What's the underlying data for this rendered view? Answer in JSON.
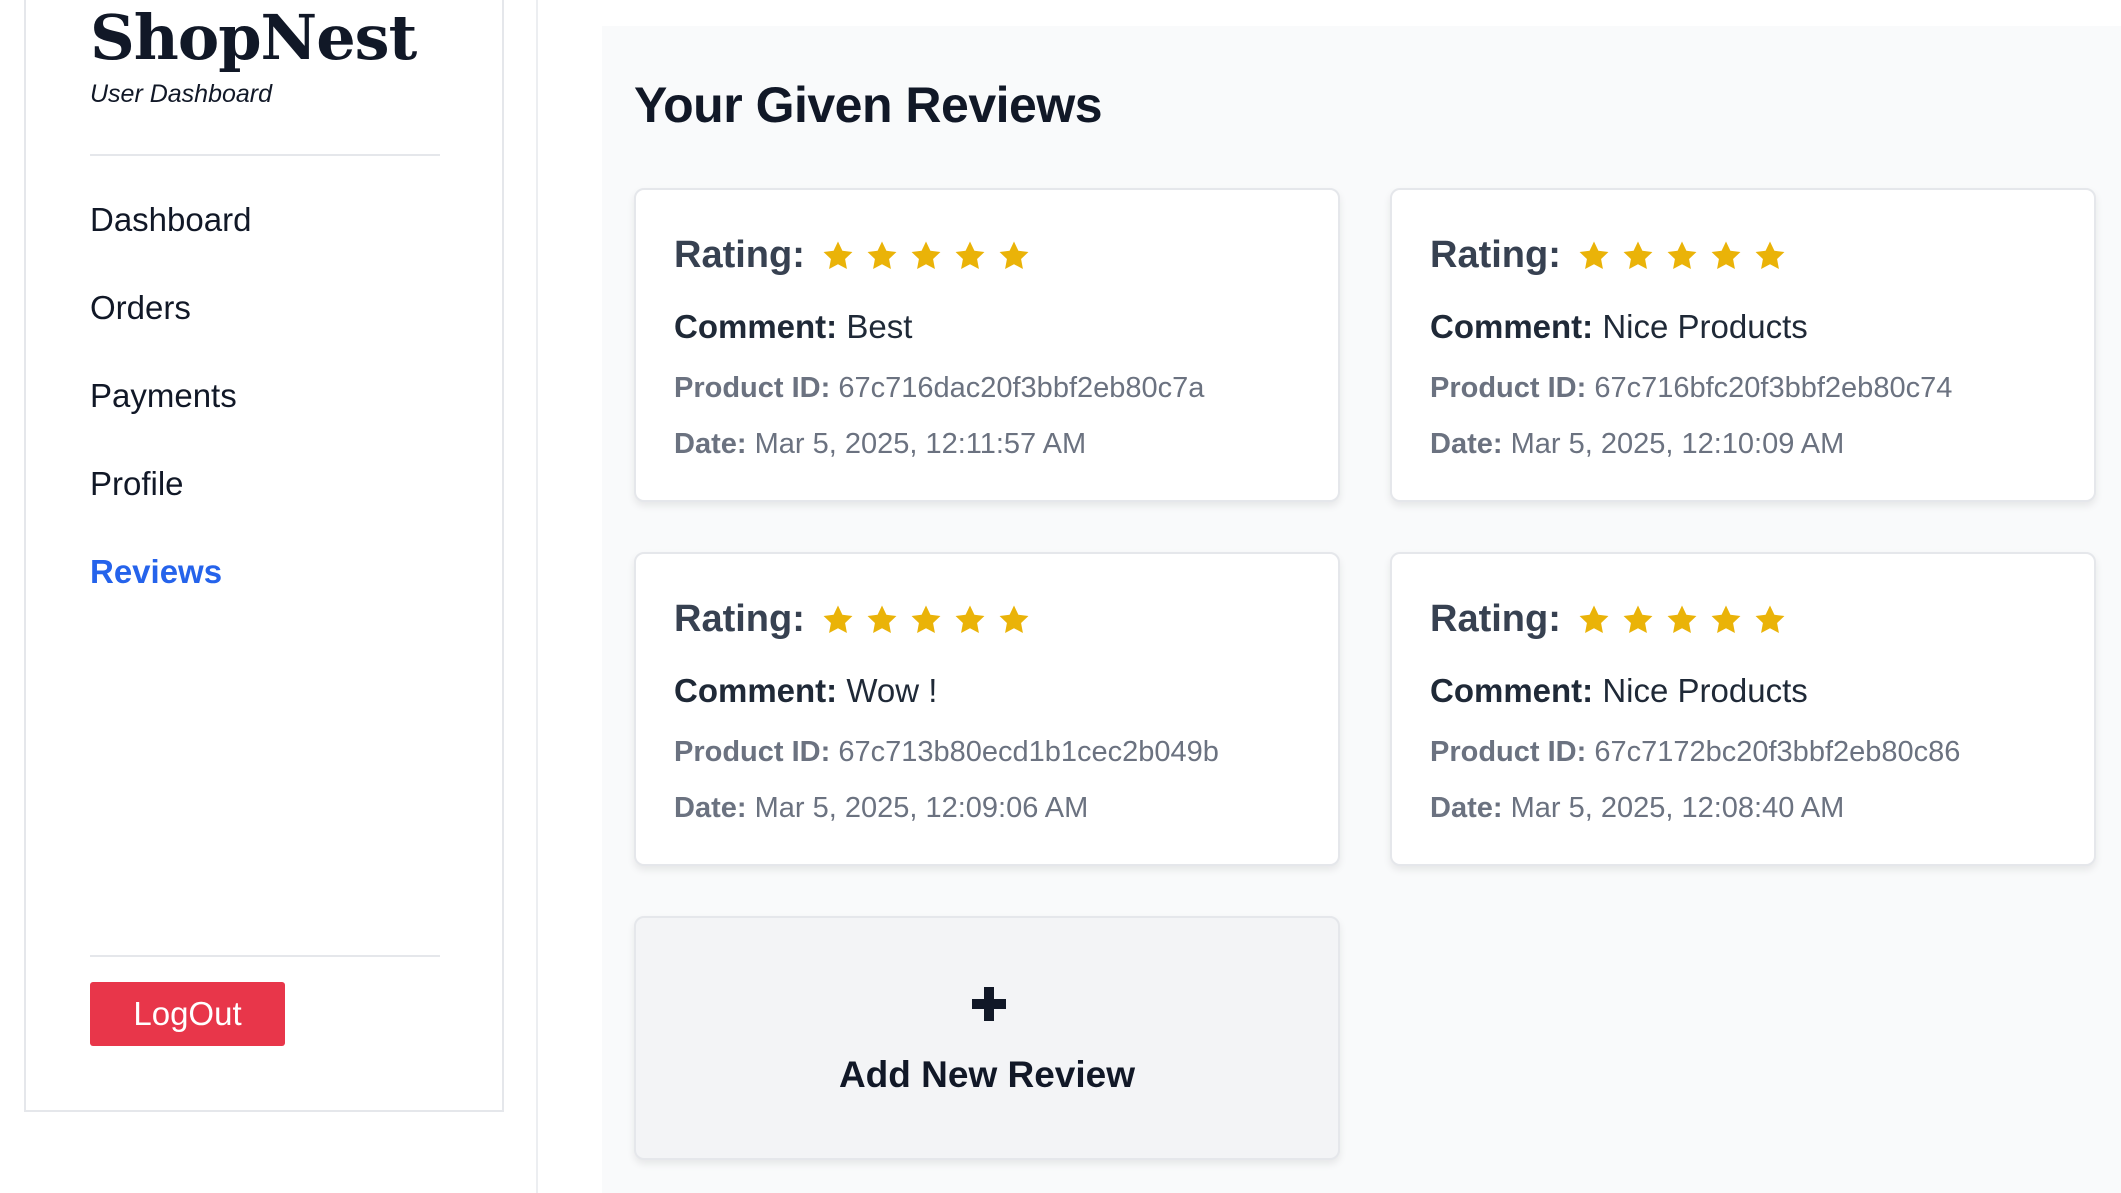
{
  "brand": {
    "name": "ShopNest",
    "subtitle": "User Dashboard"
  },
  "nav": {
    "items": [
      {
        "label": "Dashboard",
        "active": false
      },
      {
        "label": "Orders",
        "active": false
      },
      {
        "label": "Payments",
        "active": false
      },
      {
        "label": "Profile",
        "active": false
      },
      {
        "label": "Reviews",
        "active": true
      }
    ]
  },
  "logout_label": "LogOut",
  "page_title": "Your Given Reviews",
  "labels": {
    "rating": "Rating:",
    "comment": "Comment:",
    "product_id": "Product ID:",
    "date": "Date:"
  },
  "reviews": [
    {
      "rating": 5,
      "comment": "Best",
      "product_id": "67c716dac20f3bbf2eb80c7a",
      "date": "Mar 5, 2025, 12:11:57 AM"
    },
    {
      "rating": 5,
      "comment": "Nice Products",
      "product_id": "67c716bfc20f3bbf2eb80c74",
      "date": "Mar 5, 2025, 12:10:09 AM"
    },
    {
      "rating": 5,
      "comment": "Wow !",
      "product_id": "67c713b80ecd1b1cec2b049b",
      "date": "Mar 5, 2025, 12:09:06 AM"
    },
    {
      "rating": 5,
      "comment": "Nice Products",
      "product_id": "67c7172bc20f3bbf2eb80c86",
      "date": "Mar 5, 2025, 12:08:40 AM"
    }
  ],
  "add_review_label": "Add New Review",
  "colors": {
    "accent": "#2563eb",
    "logout": "#e8364a",
    "star": "#eab308"
  },
  "icons": {
    "star": "star-icon",
    "add": "plus-icon"
  }
}
